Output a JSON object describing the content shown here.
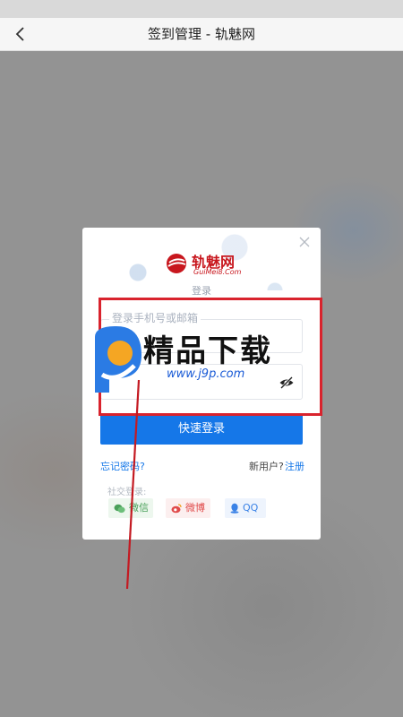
{
  "nav": {
    "title": "签到管理 - 轨魅网"
  },
  "modal": {
    "logo_text": "轨魅网",
    "logo_sub": "GuiMei8.Com",
    "heading": "登录",
    "account_placeholder": "登录手机号或邮箱",
    "password_placeholder": "",
    "submit_label": "快速登录",
    "forgot_label": "忘记密码?",
    "newuser_label": "新用户?",
    "register_label": "注册",
    "social_label": "社交登录:",
    "social": {
      "wechat": "微信",
      "weibo": "微博",
      "qq": "QQ"
    }
  },
  "watermark": {
    "title": "精品下载",
    "url": "www.j9p.com"
  },
  "colors": {
    "accent": "#1577e8",
    "brand": "#c8171e",
    "highlight": "#d9232d"
  }
}
